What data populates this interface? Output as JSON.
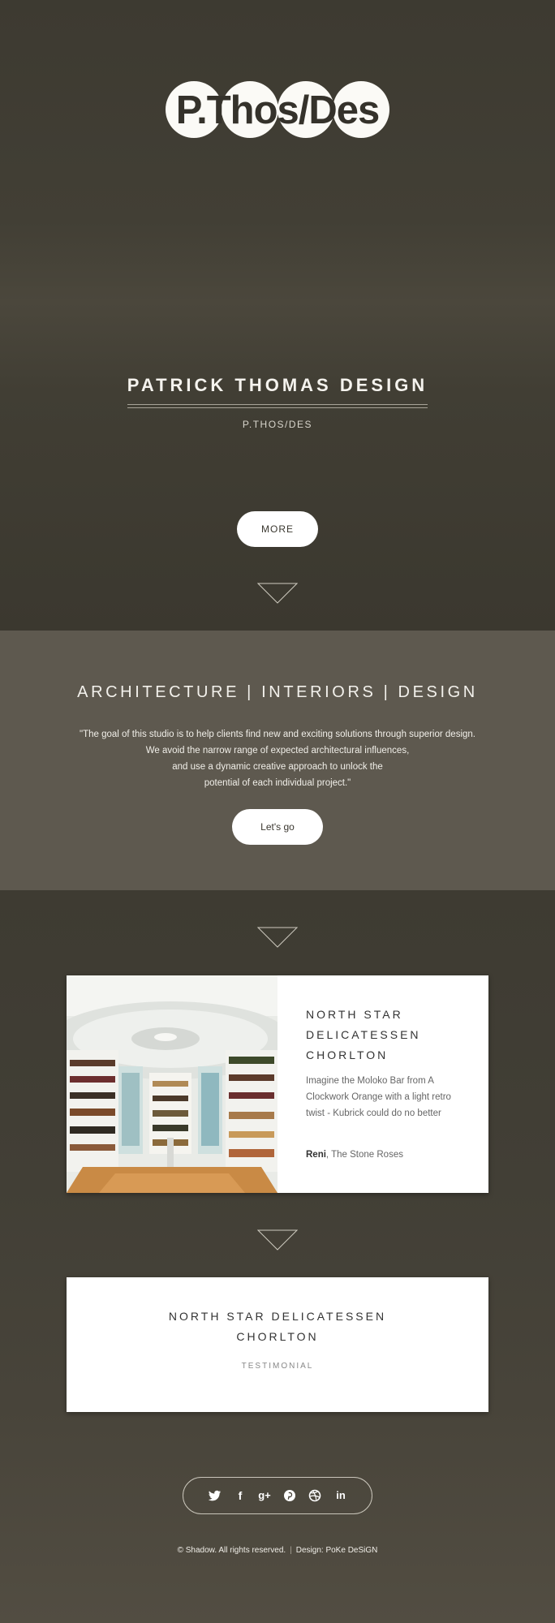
{
  "logo": {
    "text": "P.Thos/Des"
  },
  "hero": {
    "title": "PATRICK THOMAS DESIGN",
    "subtitle": "P.THOS/DES",
    "more_label": "MORE"
  },
  "band": {
    "title": "ARCHITECTURE | INTERIORS | DESIGN",
    "quote_lines": [
      "\"The goal of this studio is to help clients find new and exciting solutions through superior design.",
      "We avoid the narrow range of expected architectural influences,",
      "and use a dynamic creative approach to unlock the",
      "potential of each individual project.\""
    ],
    "button_label": "Let's go"
  },
  "project_card": {
    "title_lines": [
      "NORTH STAR",
      "DELICATESSEN",
      "CHORLTON"
    ],
    "text_lines": [
      "Imagine the Moloko Bar from A",
      "Clockwork Orange with a light retro",
      "twist - Kubrick could do no better"
    ],
    "author_name": "Reni",
    "author_rest": ", The Stone Roses"
  },
  "testimonial_card": {
    "title_lines": [
      "NORTH STAR DELICATESSEN",
      "CHORLTON"
    ],
    "label": "TESTIMONIAL"
  },
  "social": {
    "icons": [
      "twitter-icon",
      "facebook-icon",
      "google-plus-icon",
      "pinterest-icon",
      "dribbble-icon",
      "linkedin-icon"
    ],
    "glyphs": {
      "facebook": "f",
      "google_plus": "g+",
      "linkedin": "in"
    }
  },
  "footer": {
    "copyright": "© Shadow. All rights reserved.",
    "separator": "|",
    "design_label": "Design: ",
    "design_link": "PoKe DeSiGN"
  },
  "colors": {
    "background_dark": "#413d33",
    "band": "#5e594f",
    "button_fill": "#ffffff"
  }
}
